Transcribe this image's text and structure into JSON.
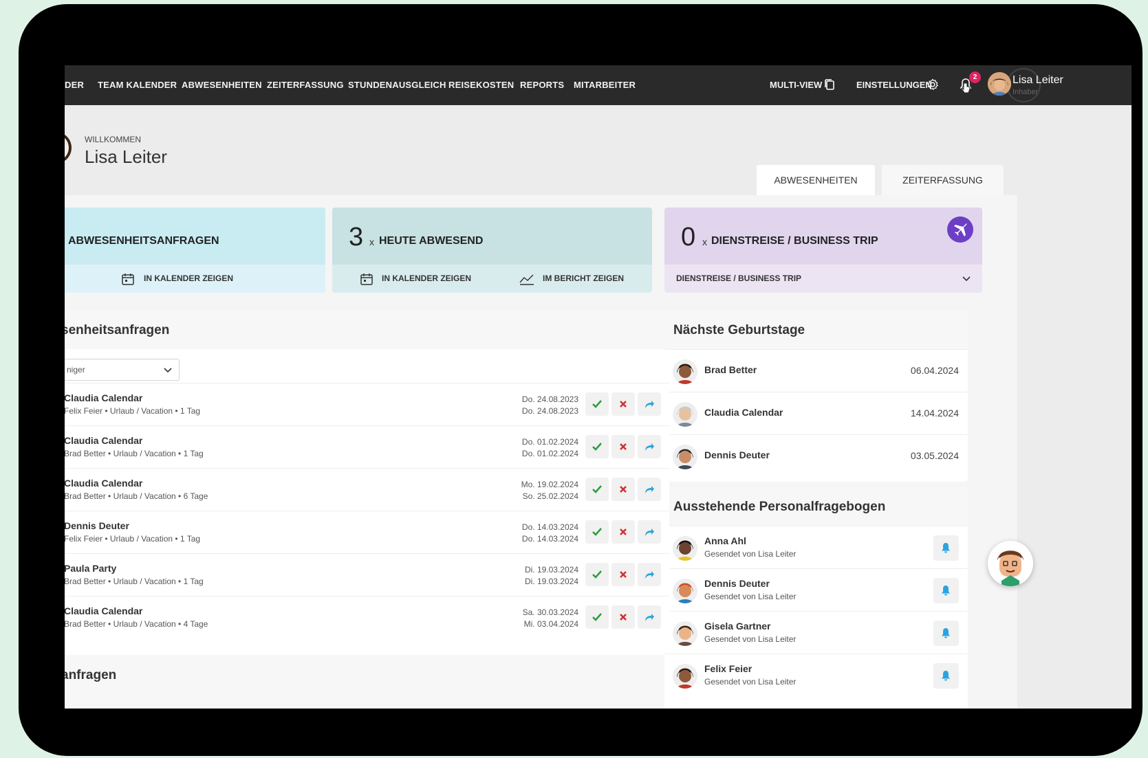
{
  "nav": {
    "items": [
      "DER",
      "TEAM KALENDER",
      "ABWESENHEITEN",
      "ZEITERFASSUNG",
      "STUNDENAUSGLEICH",
      "REISEKOSTEN",
      "REPORTS",
      "MITARBEITER"
    ],
    "multiview_label": "MULTI-VIEW",
    "settings_label": "EINSTELLUNGEN",
    "notification_count": "2",
    "user_name": "Lisa Leiter",
    "user_role": "Inhaber"
  },
  "header": {
    "welcome_label": "WILLKOMMEN",
    "user_name": "Lisa Leiter"
  },
  "tabs": [
    "ABWESENHEITEN",
    "ZEITERFASSUNG"
  ],
  "cards": {
    "requests": {
      "title": "ABWESENHEITSANFRAGEN",
      "link_calendar": "IN KALENDER ZEIGEN",
      "color": "#c9ecf3"
    },
    "absent_today": {
      "count": "3",
      "x": "x",
      "title": "HEUTE ABWESEND",
      "link_calendar": "IN KALENDER ZEIGEN",
      "link_report": "IM BERICHT ZEIGEN",
      "color": "#c8e2e3"
    },
    "business_trip": {
      "count": "0",
      "x": "x",
      "title": "DIENSTREISE / BUSINESS TRIP",
      "dropdown_value": "DIENSTREISE / BUSINESS TRIP",
      "color": "#e0d5ed",
      "icon_color": "#6c3fc5"
    }
  },
  "requests_panel": {
    "title": "senheitsanfragen",
    "filter_value": "niger",
    "rows": [
      {
        "name": "Claudia Calendar",
        "detail": "Felix Feier • Urlaub / Vacation • 1 Tag",
        "from": "Do. 24.08.2023",
        "to": "Do. 24.08.2023"
      },
      {
        "name": "Claudia Calendar",
        "detail": "Brad Better • Urlaub / Vacation • 1 Tag",
        "from": "Do. 01.02.2024",
        "to": "Do. 01.02.2024"
      },
      {
        "name": "Claudia Calendar",
        "detail": "Brad Better • Urlaub / Vacation • 6 Tage",
        "from": "Mo. 19.02.2024",
        "to": "So. 25.02.2024"
      },
      {
        "name": "Dennis Deuter",
        "detail": "Felix Feier • Urlaub / Vacation • 1 Tag",
        "from": "Do. 14.03.2024",
        "to": "Do. 14.03.2024"
      },
      {
        "name": "Paula Party",
        "detail": "Brad Better • Urlaub / Vacation • 1 Tag",
        "from": "Di. 19.03.2024",
        "to": "Di. 19.03.2024"
      },
      {
        "name": "Claudia Calendar",
        "detail": "Brad Better • Urlaub / Vacation • 4 Tage",
        "from": "Sa. 30.03.2024",
        "to": "Mi. 03.04.2024"
      }
    ],
    "accept_color": "#2e9e3f",
    "reject_color": "#d32f2f",
    "forward_color": "#2aa4e0"
  },
  "next_panel": {
    "title": "anfragen"
  },
  "birthdays": {
    "title": "Nächste Geburtstage",
    "rows": [
      {
        "name": "Brad Better",
        "date": "06.04.2024"
      },
      {
        "name": "Claudia Calendar",
        "date": "14.04.2024"
      },
      {
        "name": "Dennis Deuter",
        "date": "03.05.2024"
      }
    ]
  },
  "forms": {
    "title": "Ausstehende Personalfragebogen",
    "rows": [
      {
        "name": "Anna Ahl",
        "sub": "Gesendet von Lisa Leiter"
      },
      {
        "name": "Dennis Deuter",
        "sub": "Gesendet von Lisa Leiter"
      },
      {
        "name": "Gisela Gartner",
        "sub": "Gesendet von Lisa Leiter"
      },
      {
        "name": "Felix Feier",
        "sub": "Gesendet von Lisa Leiter"
      }
    ]
  }
}
